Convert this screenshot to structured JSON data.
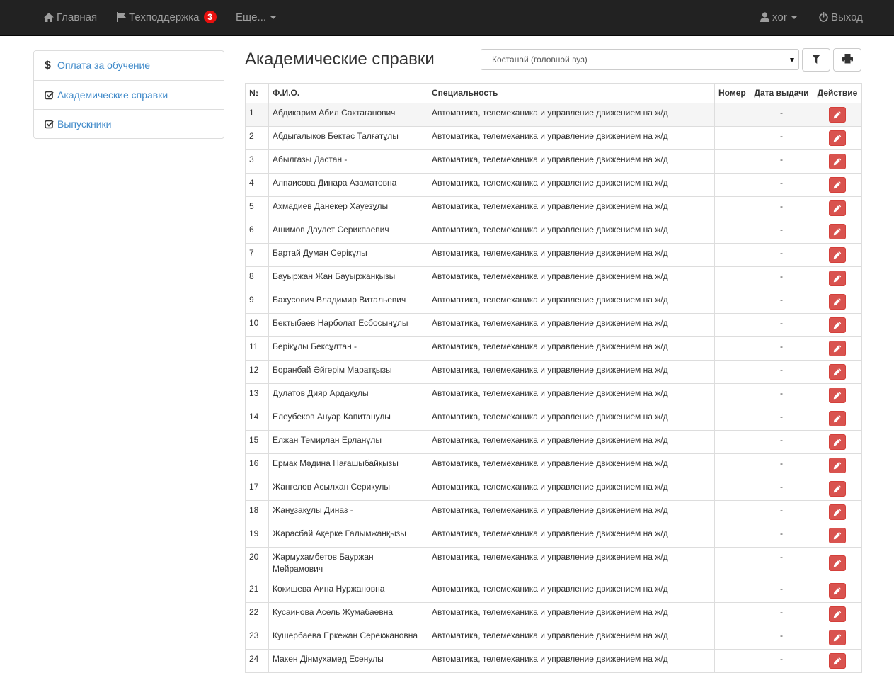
{
  "navbar": {
    "home_label": "Главная",
    "support_label": "Техподдержка",
    "support_badge": "3",
    "more_label": "Еще...",
    "user_label": "xor",
    "logout_label": "Выход"
  },
  "sidebar": {
    "items": [
      {
        "label": "Оплата за обучение",
        "icon": "dollar-icon"
      },
      {
        "label": "Академические справки",
        "icon": "check-square-icon"
      },
      {
        "label": "Выпускники",
        "icon": "check-square-icon"
      }
    ]
  },
  "main": {
    "title": "Академические справки",
    "filter_select_value": "Костанай (головной вуз)"
  },
  "table": {
    "headers": {
      "num": "№",
      "fio": "Ф.И.О.",
      "spec": "Специальность",
      "number": "Номер",
      "date": "Дата выдачи",
      "action": "Действие"
    },
    "rows": [
      {
        "num": "1",
        "fio": "Абдикарим Абил Сактаганович",
        "spec": "Автоматика, телемеханика и управление движением на ж/д",
        "number": "",
        "date": "-"
      },
      {
        "num": "2",
        "fio": "Абдыгалыков Бектас Талғатұлы",
        "spec": "Автоматика, телемеханика и управление движением на ж/д",
        "number": "",
        "date": "-"
      },
      {
        "num": "3",
        "fio": "Абылгазы Дастан -",
        "spec": "Автоматика, телемеханика и управление движением на ж/д",
        "number": "",
        "date": "-"
      },
      {
        "num": "4",
        "fio": "Алпаисова Динара Азаматовна",
        "spec": "Автоматика, телемеханика и управление движением на ж/д",
        "number": "",
        "date": "-"
      },
      {
        "num": "5",
        "fio": "Ахмадиев Данекер Хауезұлы",
        "spec": "Автоматика, телемеханика и управление движением на ж/д",
        "number": "",
        "date": "-"
      },
      {
        "num": "6",
        "fio": "Ашимов Даулет Серикпаевич",
        "spec": "Автоматика, телемеханика и управление движением на ж/д",
        "number": "",
        "date": "-"
      },
      {
        "num": "7",
        "fio": "Бартай Думан Серікұлы",
        "spec": "Автоматика, телемеханика и управление движением на ж/д",
        "number": "",
        "date": "-"
      },
      {
        "num": "8",
        "fio": "Бауыржан Жан Бауыржанқызы",
        "spec": "Автоматика, телемеханика и управление движением на ж/д",
        "number": "",
        "date": "-"
      },
      {
        "num": "9",
        "fio": "Бахусович Владимир Витальевич",
        "spec": "Автоматика, телемеханика и управление движением на ж/д",
        "number": "",
        "date": "-"
      },
      {
        "num": "10",
        "fio": "Бектыбаев Нарболат Есбосынұлы",
        "spec": "Автоматика, телемеханика и управление движением на ж/д",
        "number": "",
        "date": "-"
      },
      {
        "num": "11",
        "fio": "Берікұлы Бексұлтан -",
        "spec": "Автоматика, телемеханика и управление движением на ж/д",
        "number": "",
        "date": "-"
      },
      {
        "num": "12",
        "fio": "Боранбай Әйгерім Маратқызы",
        "spec": "Автоматика, телемеханика и управление движением на ж/д",
        "number": "",
        "date": "-"
      },
      {
        "num": "13",
        "fio": "Дулатов Дияр Ардақұлы",
        "spec": "Автоматика, телемеханика и управление движением на ж/д",
        "number": "",
        "date": "-"
      },
      {
        "num": "14",
        "fio": "Елеубеков Ануар Капитанулы",
        "spec": "Автоматика, телемеханика и управление движением на ж/д",
        "number": "",
        "date": "-"
      },
      {
        "num": "15",
        "fio": "Елжан Темирлан Ерланұлы",
        "spec": "Автоматика, телемеханика и управление движением на ж/д",
        "number": "",
        "date": "-"
      },
      {
        "num": "16",
        "fio": "Ермақ Мәдина Нағашыбайқызы",
        "spec": "Автоматика, телемеханика и управление движением на ж/д",
        "number": "",
        "date": "-"
      },
      {
        "num": "17",
        "fio": "Жангелов Асылхан Серикулы",
        "spec": "Автоматика, телемеханика и управление движением на ж/д",
        "number": "",
        "date": "-"
      },
      {
        "num": "18",
        "fio": "Жанұзақұлы Диназ -",
        "spec": "Автоматика, телемеханика и управление движением на ж/д",
        "number": "",
        "date": "-"
      },
      {
        "num": "19",
        "fio": "Жарасбай Ақерке Ғалымжанқызы",
        "spec": "Автоматика, телемеханика и управление движением на ж/д",
        "number": "",
        "date": "-"
      },
      {
        "num": "20",
        "fio": "Жармухамбетов Бауржан Мейрамович",
        "spec": "Автоматика, телемеханика и управление движением на ж/д",
        "number": "",
        "date": "-"
      },
      {
        "num": "21",
        "fio": "Кокишева Аина Нуржановна",
        "spec": "Автоматика, телемеханика и управление движением на ж/д",
        "number": "",
        "date": "-"
      },
      {
        "num": "22",
        "fio": "Кусаинова Асель Жумабаевна",
        "spec": "Автоматика, телемеханика и управление движением на ж/д",
        "number": "",
        "date": "-"
      },
      {
        "num": "23",
        "fio": "Кушербаева Еркежан Серекжановна",
        "spec": "Автоматика, телемеханика и управление движением на ж/д",
        "number": "",
        "date": "-"
      },
      {
        "num": "24",
        "fio": "Макен Дінмухамед Есенулы",
        "spec": "Автоматика, телемеханика и управление движением на ж/д",
        "number": "",
        "date": "-"
      }
    ]
  },
  "colors": {
    "navbar_bg": "#222222",
    "link": "#428bca",
    "danger": "#d9534f",
    "badge": "#e8100e"
  }
}
